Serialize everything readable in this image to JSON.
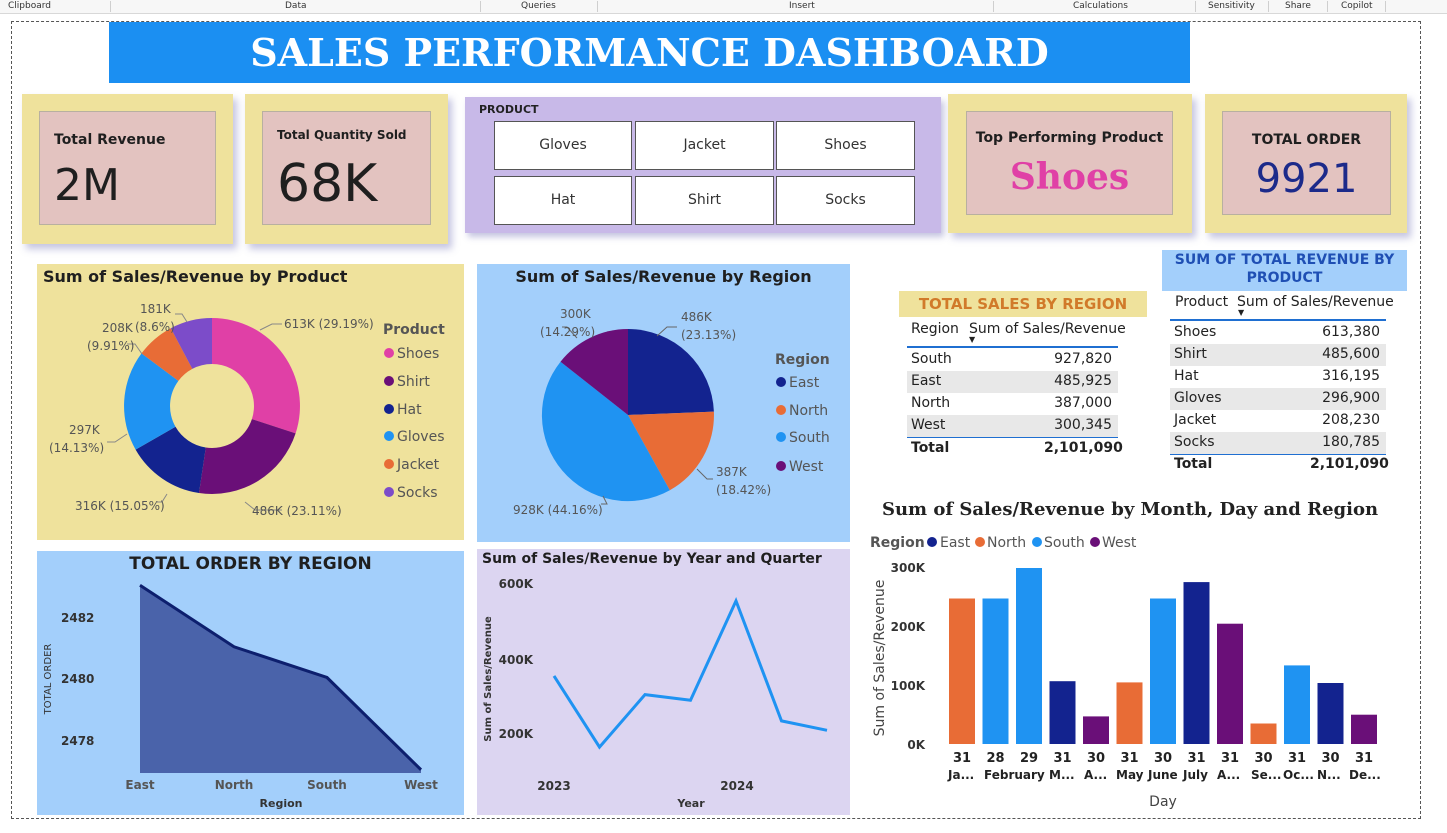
{
  "ribbon": [
    "Clipboard",
    "Data",
    "Queries",
    "Insert",
    "Calculations",
    "Sensitivity",
    "Share",
    "Copilot"
  ],
  "title": "SALES PERFORMANCE DASHBOARD",
  "kpis": {
    "revenue": {
      "label": "Total Revenue",
      "value": "2M"
    },
    "quantity": {
      "label": "Total Quantity Sold",
      "value": "68K"
    },
    "top_product": {
      "label": "Top Performing Product",
      "value": "Shoes"
    },
    "orders": {
      "label": "TOTAL ORDER",
      "value": "9921"
    }
  },
  "slicer": {
    "title": "PRODUCT",
    "options": [
      "Gloves",
      "Jacket",
      "Shoes",
      "Hat",
      "Shirt",
      "Socks"
    ]
  },
  "colors": {
    "shoes": "#e040a6",
    "shirt": "#6a0f78",
    "hat": "#13238f",
    "gloves": "#1f93f2",
    "jacket": "#e86c36",
    "socks": "#7c4cc9",
    "east": "#13238f",
    "north": "#e86c36",
    "south": "#1f93f2",
    "west": "#6a0f78"
  },
  "donut": {
    "title": "Sum of Sales/Revenue by Product",
    "legend_title": "Product",
    "legend": [
      "Shoes",
      "Shirt",
      "Hat",
      "Gloves",
      "Jacket",
      "Socks"
    ],
    "labels": {
      "shoes": "613K (29.19%)",
      "shirt": "486K (23.11%)",
      "hat": "316K (15.05%)",
      "gloves1": "297K",
      "gloves2": "(14.13%)",
      "jacket1": "208K",
      "jacket2": "(9.91%)",
      "socks1": "181K",
      "socks2": "(8.6%)"
    }
  },
  "pie": {
    "title": "Sum of Sales/Revenue by Region",
    "legend_title": "Region",
    "legend": [
      "East",
      "North",
      "South",
      "West"
    ],
    "labels": {
      "east1": "486K",
      "east2": "(23.13%)",
      "north1": "387K",
      "north2": "(18.42%)",
      "south": "928K (44.16%)",
      "west1": "300K",
      "west2": "(14.29%)"
    }
  },
  "region_table": {
    "title": "TOTAL SALES BY REGION",
    "headers": [
      "Region",
      "Sum of Sales/Revenue"
    ],
    "rows": [
      [
        "South",
        "927,820"
      ],
      [
        "East",
        "485,925"
      ],
      [
        "North",
        "387,000"
      ],
      [
        "West",
        "300,345"
      ]
    ],
    "total": [
      "Total",
      "2,101,090"
    ]
  },
  "product_table": {
    "title": "SUM OF TOTAL REVENUE BY PRODUCT",
    "headers": [
      "Product",
      "Sum of Sales/Revenue"
    ],
    "rows": [
      [
        "Shoes",
        "613,380"
      ],
      [
        "Shirt",
        "485,600"
      ],
      [
        "Hat",
        "316,195"
      ],
      [
        "Gloves",
        "296,900"
      ],
      [
        "Jacket",
        "208,230"
      ],
      [
        "Socks",
        "180,785"
      ]
    ],
    "total": [
      "Total",
      "2,101,090"
    ]
  },
  "chart_data": [
    {
      "type": "area",
      "title": "TOTAL ORDER BY REGION",
      "xlabel": "Region",
      "ylabel": "TOTAL ORDER",
      "categories": [
        "East",
        "North",
        "South",
        "West"
      ],
      "values": [
        2483,
        2481,
        2480,
        2477
      ],
      "yticks": [
        "2482",
        "2480",
        "2478"
      ],
      "ylim": [
        2477,
        2483
      ]
    },
    {
      "type": "line",
      "title": "Sum of Sales/Revenue by Year and Quarter",
      "xlabel": "Year",
      "ylabel": "Sum of Sales/Revenue",
      "x_tick_labels": [
        "2023",
        "2024"
      ],
      "yticks": [
        "600K",
        "400K",
        "200K"
      ],
      "values": [
        355000,
        165000,
        305000,
        290000,
        555000,
        235000,
        210000
      ],
      "ylim": [
        150000,
        600000
      ]
    },
    {
      "type": "bar",
      "title": "Sum of Sales/Revenue by Month, Day and Region",
      "xlabel": "Day",
      "ylabel": "Sum of Sales/Revenue",
      "legend_title": "Region",
      "legend": [
        "East",
        "North",
        "South",
        "West"
      ],
      "yticks": [
        "300K",
        "200K",
        "100K",
        "0K"
      ],
      "ylim": [
        0,
        300000
      ],
      "days": [
        "31",
        "28",
        "29",
        "31",
        "30",
        "31",
        "30",
        "31",
        "31",
        "30",
        "31",
        "30",
        "31"
      ],
      "months": [
        "Ja...",
        "February",
        "M...",
        "A...",
        "May",
        "June",
        "July",
        "A...",
        "Se...",
        "Oc...",
        "N...",
        "De..."
      ],
      "values": [
        248000,
        248000,
        300000,
        107000,
        47000,
        105000,
        248000,
        276000,
        205000,
        35000,
        134000,
        104000,
        50000
      ],
      "regions": [
        "North",
        "South",
        "South",
        "East",
        "West",
        "North",
        "South",
        "East",
        "West",
        "North",
        "South",
        "East",
        "West"
      ]
    }
  ]
}
